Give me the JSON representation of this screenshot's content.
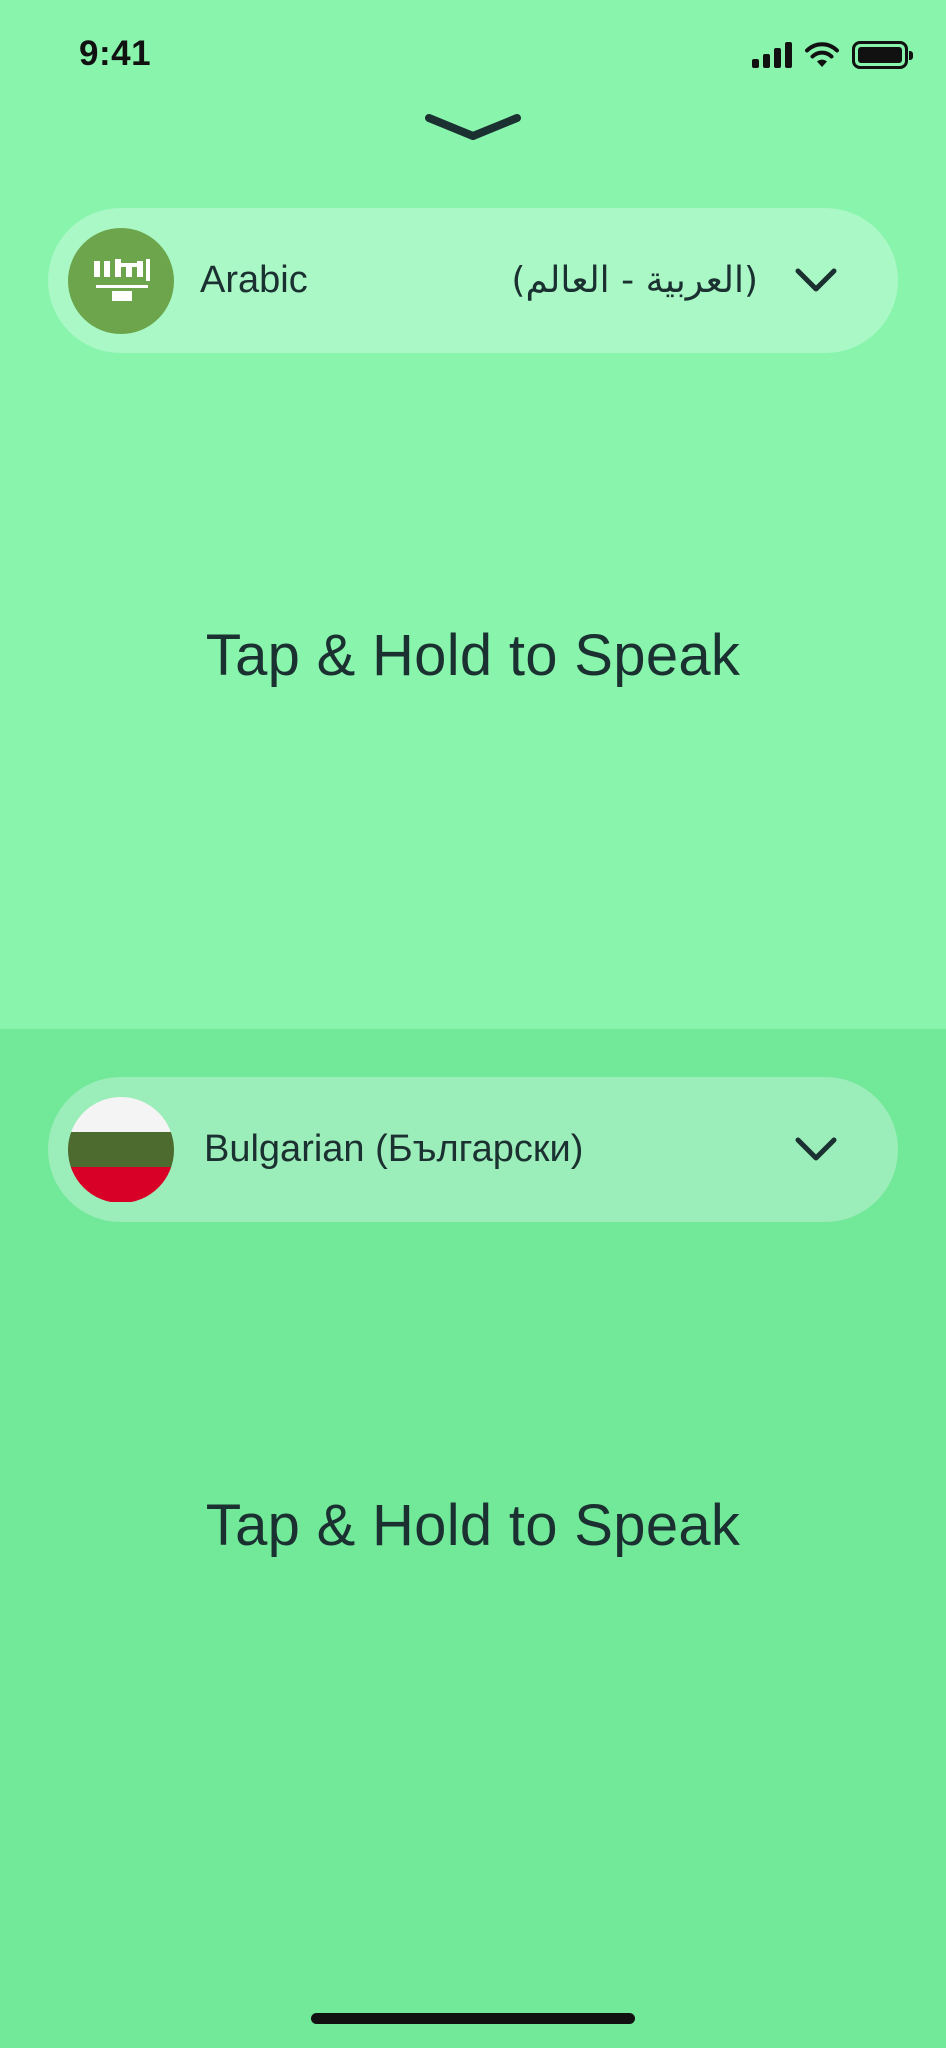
{
  "status_bar": {
    "time": "9:41"
  },
  "top_panel": {
    "language": {
      "name": "Arabic",
      "native": "(العربية - العالم)",
      "flag": "saudi-arabia-flag"
    },
    "prompt": "Tap & Hold to Speak"
  },
  "bottom_panel": {
    "language": {
      "name": "Bulgarian (Български)",
      "flag": "bulgaria-flag"
    },
    "prompt": "Tap & Hold to Speak"
  },
  "icons": {
    "collapse": "chevron-down-icon",
    "dropdown": "chevron-down-icon",
    "signal": "cellular-signal-icon",
    "wifi": "wifi-icon",
    "battery": "battery-icon"
  },
  "colors": {
    "top_background": "#88f4ac",
    "bottom_background": "#72e899",
    "text": "#1b3030",
    "saudi_green": "#6da54c",
    "bulgaria_white": "#f4f4f4",
    "bulgaria_green": "#4d6b2e",
    "bulgaria_red": "#d80027"
  }
}
